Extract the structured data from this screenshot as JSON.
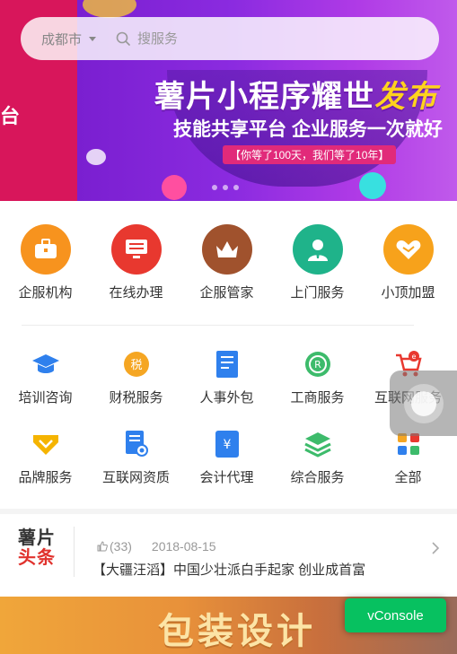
{
  "banner": {
    "left_text": "台",
    "headline": "薯片小程序耀世",
    "headline_highlight": "发布",
    "subline": "技能共享平台 企业服务一次就好",
    "tagline": "【你等了100天，我们等了10年】"
  },
  "search": {
    "city": "成都市",
    "placeholder": "搜服务"
  },
  "primary_services": [
    {
      "label": "企服机构",
      "icon": "briefcase-icon",
      "color": "#f7931e"
    },
    {
      "label": "在线办理",
      "icon": "monitor-icon",
      "color": "#e8382f"
    },
    {
      "label": "企服管家",
      "icon": "crown-icon",
      "color": "#a0522d"
    },
    {
      "label": "上门服务",
      "icon": "person-icon",
      "color": "#1fb38a"
    },
    {
      "label": "小顶加盟",
      "icon": "handshake-icon",
      "color": "#f7a21b"
    }
  ],
  "secondary_services_row1": [
    {
      "label": "培训咨询",
      "icon": "graduation-cap-icon",
      "color": "#2f80ed"
    },
    {
      "label": "财税服务",
      "icon": "tax-icon",
      "color": "#f5a623"
    },
    {
      "label": "人事外包",
      "icon": "document-icon",
      "color": "#2f80ed"
    },
    {
      "label": "工商服务",
      "icon": "registered-icon",
      "color": "#3dbb6b"
    },
    {
      "label": "互联网服务",
      "icon": "cart-icon",
      "color": "#e8382f"
    }
  ],
  "secondary_services_row2": [
    {
      "label": "品牌服务",
      "icon": "diamond-icon",
      "color": "#f5b400"
    },
    {
      "label": "互联网资质",
      "icon": "certificate-icon",
      "color": "#2f80ed"
    },
    {
      "label": "会计代理",
      "icon": "accounting-icon",
      "color": "#2f80ed"
    },
    {
      "label": "综合服务",
      "icon": "layers-icon",
      "color": "#3dbb6b"
    },
    {
      "label": "全部",
      "icon": "grid-icon",
      "color": "#f5a623"
    }
  ],
  "news": {
    "logo_line1": "薯片",
    "logo_line2": "头条",
    "likes": "(33)",
    "date": "2018-08-15",
    "tag": "【大疆汪滔】",
    "title": "中国少壮派白手起家 创业成首富"
  },
  "bottom_banner": {
    "text": "包装设计"
  },
  "vconsole": {
    "label": "vConsole"
  }
}
